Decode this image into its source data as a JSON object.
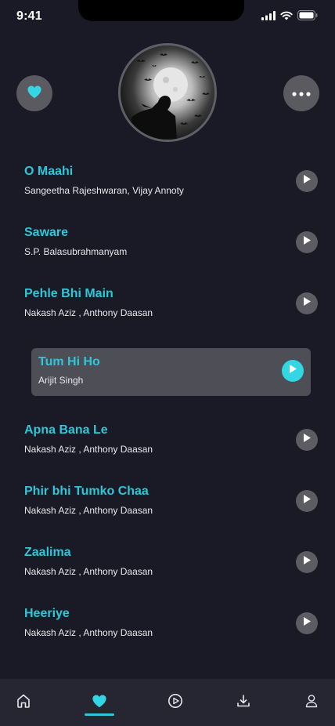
{
  "status_bar": {
    "time": "9:41"
  },
  "header": {
    "favorite_icon": "heart-icon",
    "more_icon": "more-horizontal-icon",
    "cover_icon": "album-cover-moon-silhouette"
  },
  "songs": [
    {
      "title": "O Maahi",
      "artist": "Sangeetha Rajeshwaran, Vijay Annoty"
    },
    {
      "title": "Saware",
      "artist": "S.P. Balasubrahmanyam"
    },
    {
      "title": "Pehle Bhi Main",
      "artist": "Nakash Aziz , Anthony Daasan"
    },
    {
      "title": "Tum Hi Ho",
      "artist": "Arijit Singh"
    },
    {
      "title": "Apna Bana Le",
      "artist": "Nakash Aziz , Anthony Daasan"
    },
    {
      "title": "Phir bhi Tumko Chaa",
      "artist": "Nakash Aziz , Anthony Daasan"
    },
    {
      "title": "Zaalima",
      "artist": "Nakash Aziz , Anthony Daasan"
    },
    {
      "title": "Heeriye",
      "artist": "Nakash Aziz , Anthony Daasan"
    }
  ],
  "active_song_index": 3,
  "bottom_nav": {
    "items": [
      "home-icon",
      "heart-icon",
      "play-circle-icon",
      "download-icon",
      "user-icon"
    ],
    "active": "heart-icon"
  },
  "colors": {
    "background": "#1a1a26",
    "accent": "#2ec7d9",
    "active_play": "#33d6e3",
    "card": "#4e4e56",
    "nav_bg": "#262633"
  }
}
